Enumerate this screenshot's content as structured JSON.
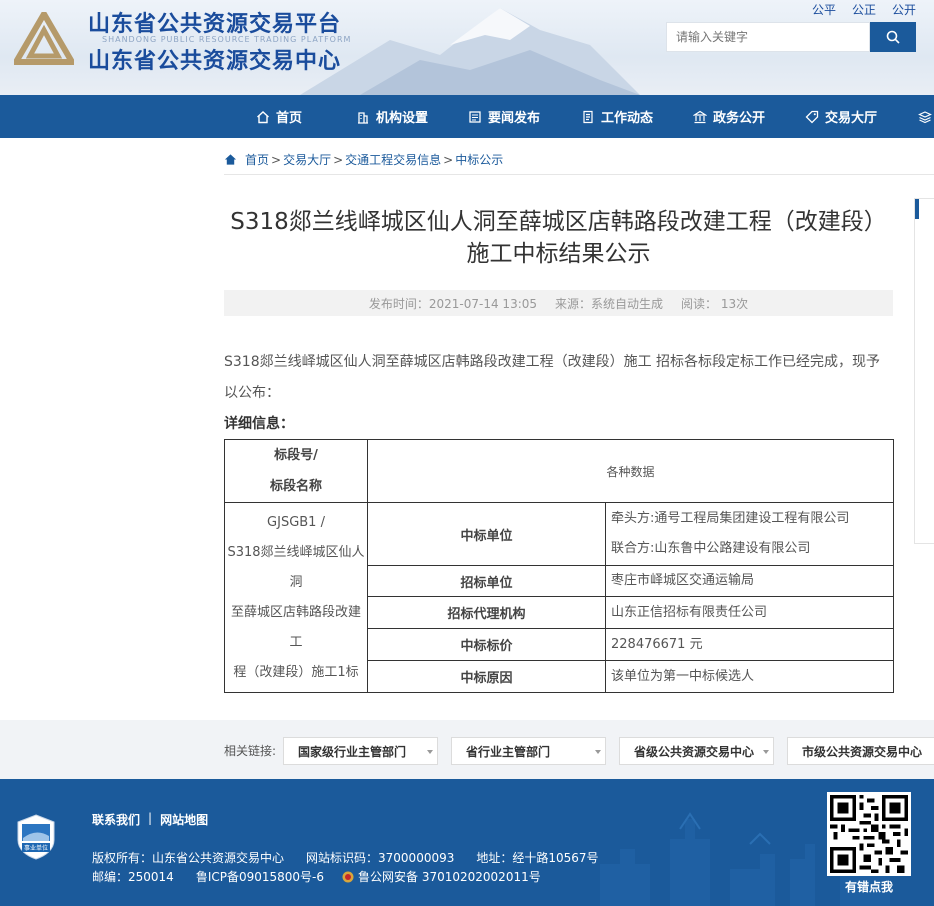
{
  "header": {
    "title_cn_1": "山东省公共资源交易平台",
    "title_en": "SHANDONG PUBLIC RESOURCE TRADING PLATFORM",
    "title_cn_2": "山东省公共资源交易中心",
    "top_links": [
      "公平",
      "公正",
      "公开"
    ],
    "search_placeholder": "请输入关键字"
  },
  "nav": {
    "items": [
      {
        "label": "首页",
        "icon": "home-icon"
      },
      {
        "label": "机构设置",
        "icon": "building-icon"
      },
      {
        "label": "要闻发布",
        "icon": "news-icon"
      },
      {
        "label": "工作动态",
        "icon": "document-icon"
      },
      {
        "label": "政务公开",
        "icon": "bank-icon"
      },
      {
        "label": "交易大厅",
        "icon": "tag-icon"
      }
    ]
  },
  "breadcrumb": {
    "items": [
      "首页",
      "交易大厅",
      "交通工程交易信息",
      "中标公示"
    ],
    "separator": ">"
  },
  "article": {
    "title": "S318郯兰线峄城区仙人洞至薛城区店韩路段改建工程（改建段）施工中标结果公示",
    "publish_time": "发布时间：2021-07-14 13:05",
    "source": "来源：系统自动生成",
    "views": "阅读： 13次",
    "intro": "S318郯兰线峄城区仙人洞至薛城区店韩路段改建工程（改建段）施工 招标各标段定标工作已经完成，现予以公布：",
    "detail_label": "详细信息："
  },
  "table": {
    "header_col1_line1": "标段号/",
    "header_col1_line2": "标段名称",
    "header_col2": "各种数据",
    "segment_line1": "GJSGB1 /",
    "segment_line2": "S318郯兰线峄城区仙人洞",
    "segment_line3": "至薛城区店韩路段改建工",
    "segment_line4": "程（改建段）施工1标",
    "rows": [
      {
        "key": "中标单位",
        "value_1": "牵头方:通号工程局集团建设工程有限公司",
        "value_2": "联合方:山东鲁中公路建设有限公司"
      },
      {
        "key": "招标单位",
        "value_1": "枣庄市峄城区交通运输局"
      },
      {
        "key": "招标代理机构",
        "value_1": "山东正信招标有限责任公司"
      },
      {
        "key": "中标标价",
        "value_1": "228476671 元"
      },
      {
        "key": "中标原因",
        "value_1": "该单位为第一中标候选人"
      }
    ]
  },
  "links_bar": {
    "label": "相关链接:",
    "selects": [
      "国家级行业主管部门",
      "省行业主管部门",
      "省级公共资源交易中心",
      "市级公共资源交易中心"
    ]
  },
  "footer": {
    "links": [
      "联系我们",
      "|",
      "网站地图"
    ],
    "badge_text": "事业单位",
    "copyright": "版权所有：山东省公共资源交易中心",
    "site_code": "网站标识码：3700000093",
    "address": "地址：经十路10567号",
    "postcode": "邮编：250014",
    "icp": "鲁ICP备09015800号-6",
    "police": "鲁公网安备 37010202002011号",
    "qr_label": "有错点我"
  },
  "colors": {
    "brand_blue": "#1b5a9b",
    "title_blue": "#1a4c9c"
  }
}
